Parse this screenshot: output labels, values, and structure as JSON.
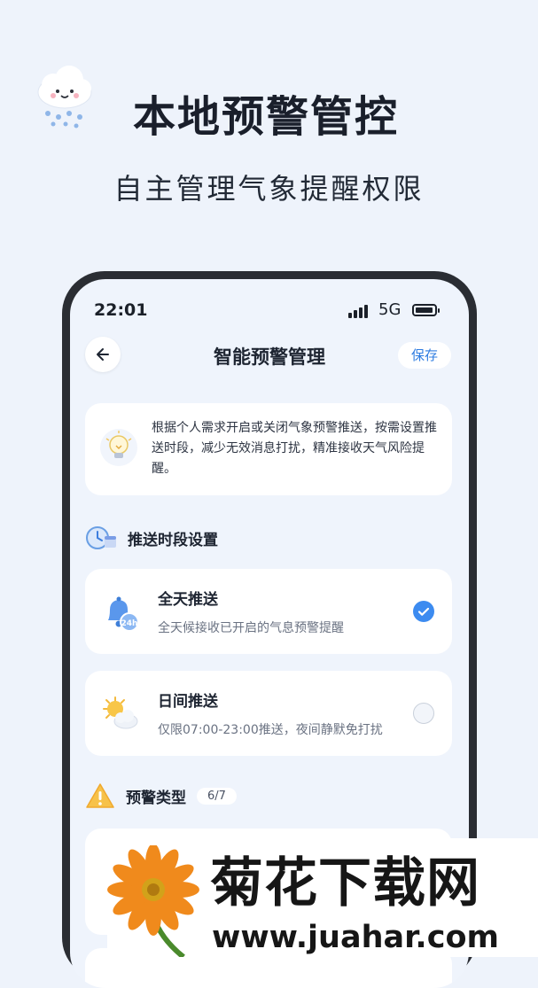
{
  "promo": {
    "title": "本地预警管控",
    "subtitle": "自主管理气象提醒权限"
  },
  "status_bar": {
    "time": "22:01",
    "network": "5G"
  },
  "nav": {
    "title": "智能预警管理",
    "save_label": "保存"
  },
  "info": {
    "text": "根据个人需求开启或关闭气象预警推送，按需设置推送时段，减少无效消息打扰，精准接收天气风险提醒。"
  },
  "push_section": {
    "title": "推送时段设置",
    "options": [
      {
        "title": "全天推送",
        "desc": "全天候接收已开启的气息预警提醒",
        "selected": true,
        "badge": "24h"
      },
      {
        "title": "日间推送",
        "desc": "仅限07:00-23:00推送，夜间静默免打扰",
        "selected": false
      }
    ]
  },
  "alert_section": {
    "title": "预警类型",
    "count": "6/7"
  },
  "watermark": {
    "title": "菊花下载网",
    "url": "www.juahar.com"
  },
  "colors": {
    "accent": "#3c8bf0",
    "background": "#eef3fb"
  }
}
